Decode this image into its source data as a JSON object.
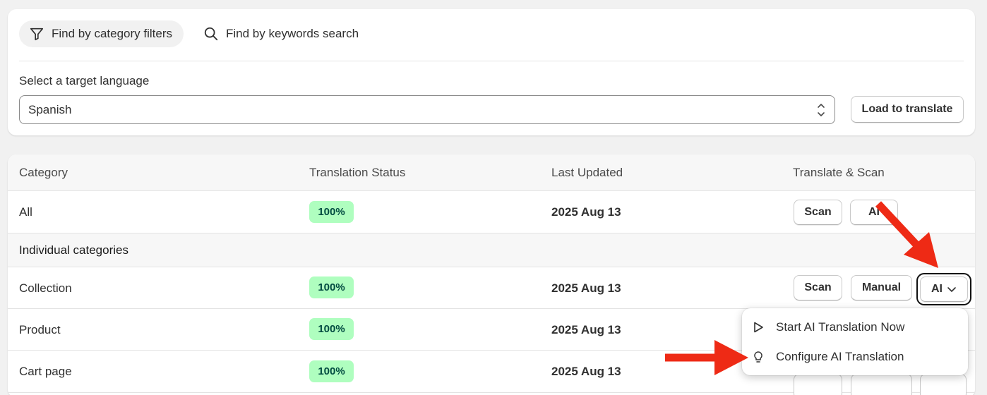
{
  "filters": {
    "tabs": [
      {
        "label": "Find by category filters",
        "icon": "filter-icon",
        "active": true
      },
      {
        "label": "Find by keywords search",
        "icon": "search-icon",
        "active": false
      }
    ],
    "language_label": "Select a target language",
    "language_value": "Spanish",
    "load_button": "Load to translate"
  },
  "table": {
    "headers": [
      "Category",
      "Translation Status",
      "Last Updated",
      "Translate & Scan"
    ],
    "all_row": {
      "category": "All",
      "status": "100%",
      "updated": "2025 Aug 13",
      "scan": "Scan",
      "ai": "AI"
    },
    "section_label": "Individual categories",
    "rows": [
      {
        "category": "Collection",
        "status": "100%",
        "updated": "2025 Aug 13",
        "scan": "Scan",
        "manual": "Manual",
        "ai": "AI"
      },
      {
        "category": "Product",
        "status": "100%",
        "updated": "2025 Aug 13"
      },
      {
        "category": "Cart page",
        "status": "100%",
        "updated": "2025 Aug 13"
      }
    ]
  },
  "ai_menu": {
    "items": [
      {
        "label": "Start AI Translation Now",
        "icon": "play-icon"
      },
      {
        "label": "Configure AI Translation",
        "icon": "lightbulb-icon"
      }
    ]
  },
  "colors": {
    "badge_bg": "#affebf",
    "badge_text": "#014b40",
    "arrow": "#ee2a15"
  }
}
